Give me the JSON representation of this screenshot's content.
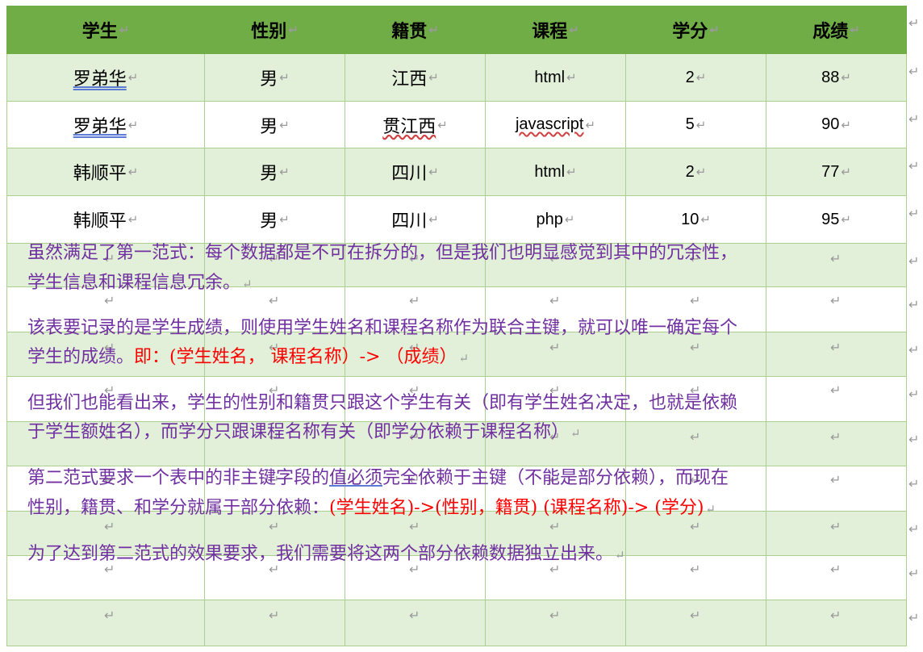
{
  "table": {
    "headers": [
      "学生",
      "性别",
      "籍贯",
      "课程",
      "学分",
      "成绩"
    ],
    "rows": [
      [
        "罗弟华",
        "男",
        "江西",
        "html",
        "2",
        "88"
      ],
      [
        "罗弟华",
        "男",
        "贯江西",
        "javascript",
        "5",
        "90"
      ],
      [
        "韩顺平",
        "男",
        "四川",
        "html",
        "2",
        "77"
      ],
      [
        "韩顺平",
        "男",
        "四川",
        "php",
        "10",
        "95"
      ]
    ],
    "header_bg": "#70ad47",
    "band_bg": "#e2efd9",
    "border_color": "#a9d08e"
  },
  "paragraphs": {
    "p1": {
      "line1": "虽然满足了第一范式：每个数据都是不可在拆分的，但是我们也明显感觉到其中的冗余性，",
      "line2": "学生信息和课程信息冗余。"
    },
    "p2": {
      "line1": "该表要记录的是学生成绩，则使用学生姓名和课程名称作为联合主键，就可以唯一确定每个",
      "line2_a": "学生的成绩。",
      "line2_b": "即：(学生姓名，  课程名称）->  （成绩）"
    },
    "p3": {
      "line1": "但我们也能看出来，学生的性别和籍贯只跟这个学生有关（即有学生姓名决定，也就是依赖",
      "line2": "于学生额姓名），而学分只跟课程名称有关（即学分依赖于课程名称）"
    },
    "p4": {
      "line1_a": "第二范式要求一个表中的非主键字段的",
      "line1_b": "值必须",
      "line1_c": "完全依赖于主键（不能是部分依赖），而现在",
      "line2_a": "性别，籍贯、和学分就属于部分依赖：",
      "line2_b": "(学生姓名)->(性别，籍贯) (课程名称)-> (学分)"
    },
    "p5": {
      "line1": "为了达到第二范式的效果要求，我们需要将这两个部分依赖数据独立出来。"
    },
    "text_color": "#7030a0",
    "highlight_color": "#ff0000"
  },
  "marks": {
    "return": "↵"
  }
}
